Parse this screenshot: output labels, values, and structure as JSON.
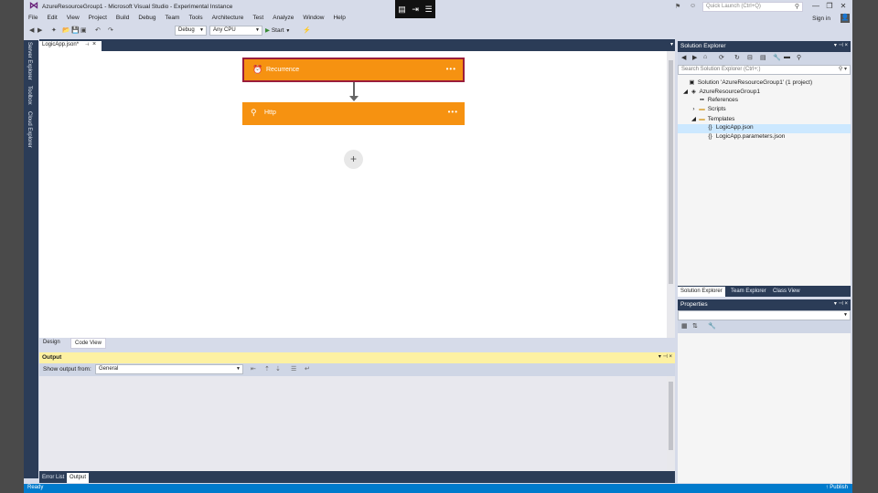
{
  "window": {
    "title": "AzureResourceGroup1 - Microsoft Visual Studio - Experimental Instance",
    "quick_launch_placeholder": "Quick Launch (Ctrl+Q)",
    "sign_in": "Sign in",
    "controls": {
      "minimize": "—",
      "restore": "❐",
      "close": "✕"
    }
  },
  "overlay_icons": [
    "▤",
    "⇥",
    "☰"
  ],
  "menu": [
    "File",
    "Edit",
    "View",
    "Project",
    "Build",
    "Debug",
    "Team",
    "Tools",
    "Architecture",
    "Test",
    "Analyze",
    "Window",
    "Help"
  ],
  "toolbar": {
    "configuration": "Debug",
    "platform": "Any CPU",
    "start_label": "Start",
    "start_icon": "▶"
  },
  "left_tabs": [
    "Server Explorer",
    "Toolbox",
    "Cloud Explorer"
  ],
  "document": {
    "tab_label": "LogicApp.json*",
    "cards": [
      {
        "label": "Recurrence",
        "icon": "⏰",
        "more": "•••"
      },
      {
        "label": "Http",
        "icon": "⚲",
        "more": "•••"
      }
    ],
    "add_step": "+",
    "view_tabs": [
      "Design",
      "Code View"
    ]
  },
  "output": {
    "title": "Output",
    "show_from_label": "Show output from:",
    "source": "General"
  },
  "bottom_tabs": [
    "Error List",
    "Output"
  ],
  "solution_explorer": {
    "title": "Solution Explorer",
    "search_placeholder": "Search Solution Explorer (Ctrl+;)",
    "tree": [
      {
        "label": "Solution 'AzureResourceGroup1' (1 project)",
        "icon": "▣",
        "indent": 0,
        "expander": ""
      },
      {
        "label": "AzureResourceGroup1",
        "icon": "◈",
        "indent": 1,
        "expander": "◢"
      },
      {
        "label": "References",
        "icon": "▪▪",
        "indent": 2,
        "expander": ""
      },
      {
        "label": "Scripts",
        "icon": "▬",
        "indent": 2,
        "expander": "›"
      },
      {
        "label": "Templates",
        "icon": "▬",
        "indent": 2,
        "expander": "◢"
      },
      {
        "label": "LogicApp.json",
        "icon": "{}",
        "indent": 3,
        "expander": ""
      },
      {
        "label": "LogicApp.parameters.json",
        "icon": "{}",
        "indent": 3,
        "expander": ""
      }
    ],
    "tabs": [
      "Solution Explorer",
      "Team Explorer",
      "Class View"
    ]
  },
  "properties": {
    "title": "Properties"
  },
  "status": {
    "text": "Ready",
    "publish": "↑ Publish"
  },
  "colors": {
    "accent": "#007acc",
    "card": "#f69211",
    "card_selected_border": "#9a1d3b",
    "tool_window_header": "#2b3c57"
  }
}
